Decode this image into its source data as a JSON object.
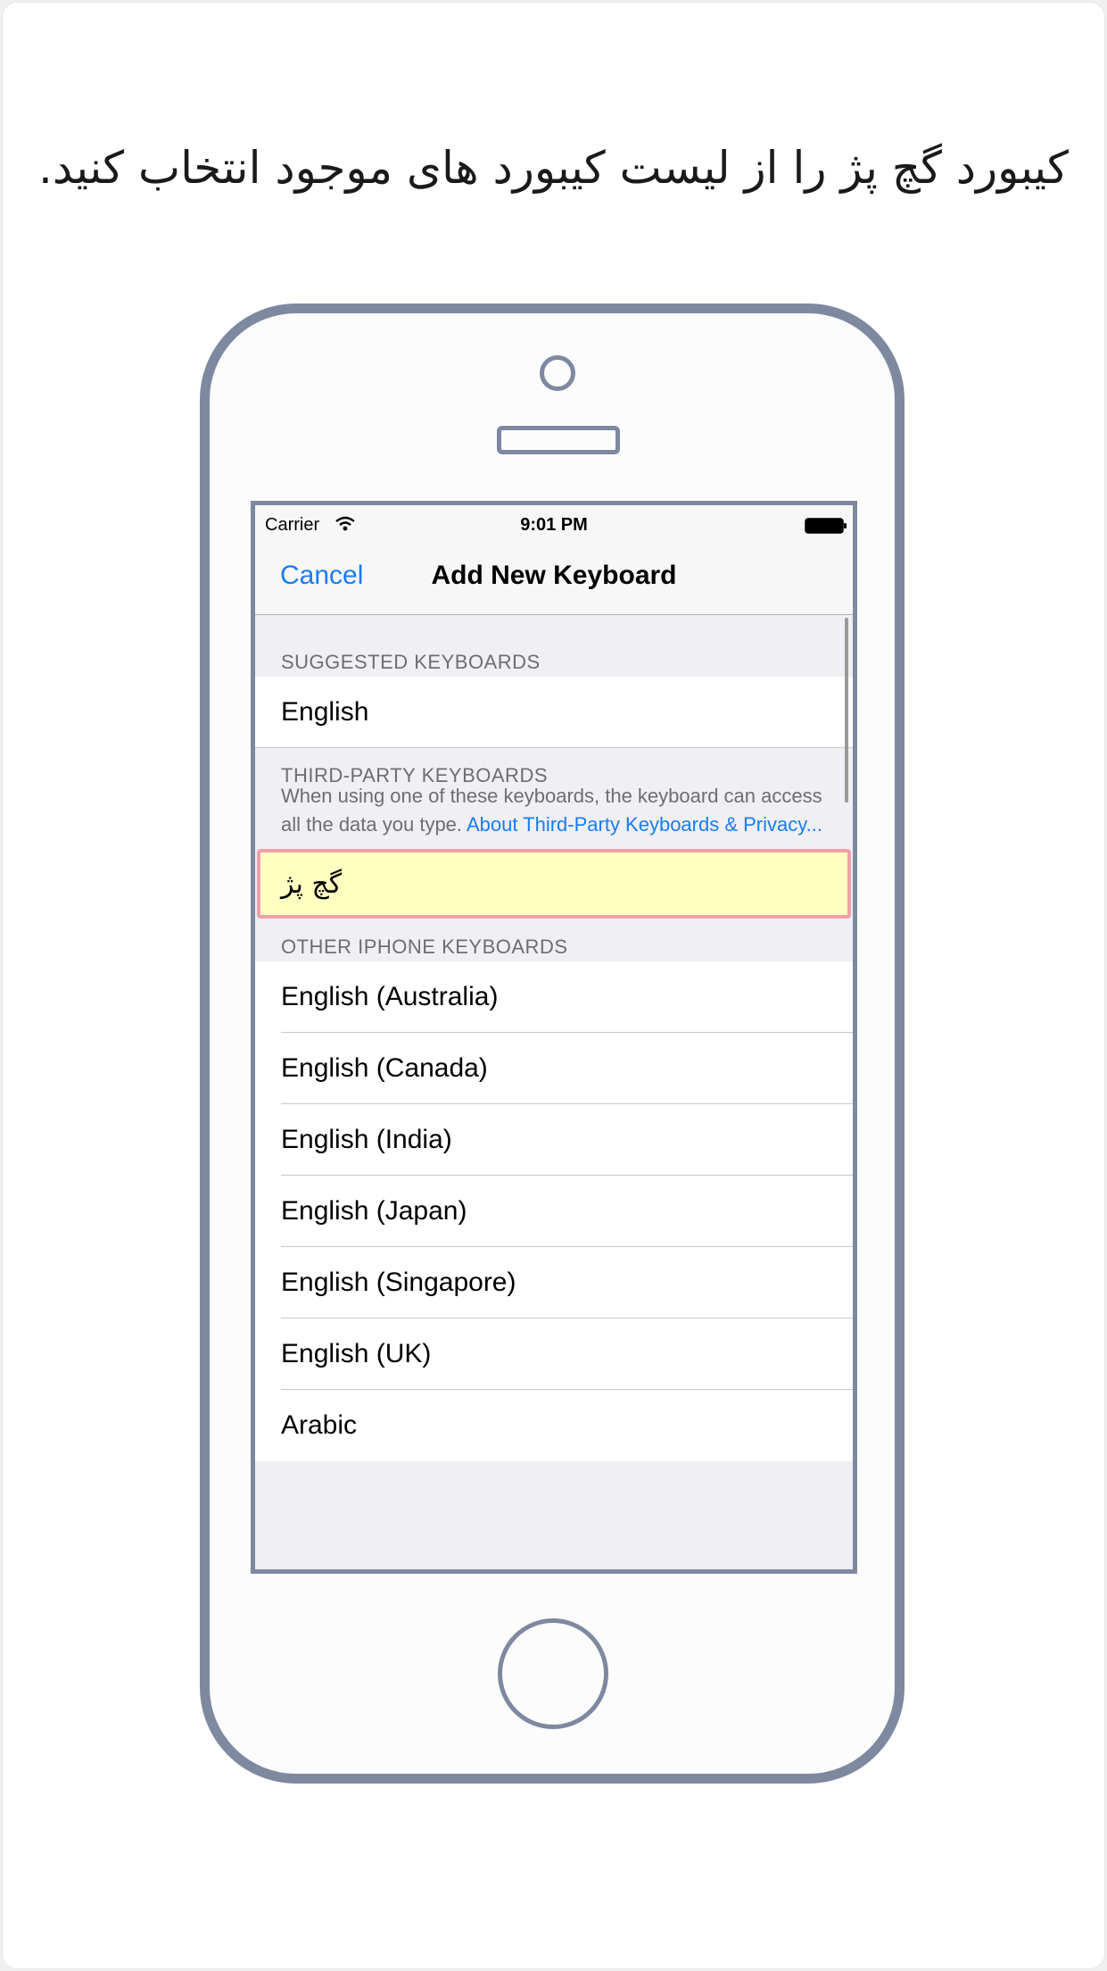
{
  "caption": "کیبورد گچ پژ را از لیست کیبورد های موجود انتخاب کنید.",
  "status_bar": {
    "carrier": "Carrier",
    "time": "9:01 PM"
  },
  "nav_bar": {
    "cancel_label": "Cancel",
    "title": "Add New Keyboard"
  },
  "suggested": {
    "header": "SUGGESTED KEYBOARDS",
    "items": [
      "English"
    ]
  },
  "third_party": {
    "header": "THIRD-PARTY KEYBOARDS",
    "description": "When using one of these keyboards, the keyboard can access all the data you type.",
    "link": "About Third-Party Keyboards & Privacy...",
    "items": [
      "گچ پژ"
    ]
  },
  "other": {
    "header": "OTHER IPHONE KEYBOARDS",
    "items": [
      "English (Australia)",
      "English (Canada)",
      "English (India)",
      "English (Japan)",
      "English (Singapore)",
      "English (UK)",
      "Arabic"
    ]
  },
  "colors": {
    "phone_frame": "#7e89a0",
    "link_blue": "#1a7cf0",
    "highlight_fill": "#ffffc1",
    "highlight_border": "#f0a0a8"
  }
}
